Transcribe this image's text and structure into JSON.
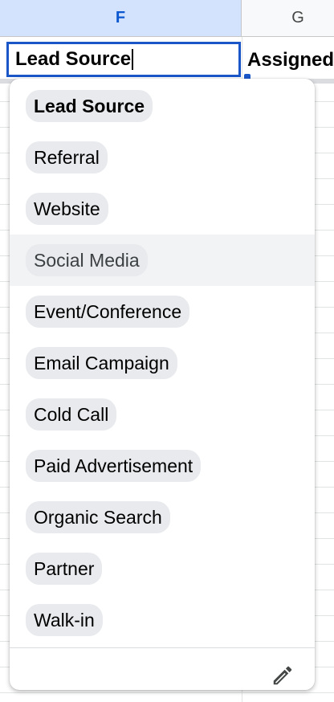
{
  "columns": {
    "f_label": "F",
    "g_label": "G"
  },
  "header_row": {
    "f_value": "Lead Source",
    "g_value": "Assigned"
  },
  "dropdown": {
    "options": [
      {
        "label": "Lead Source"
      },
      {
        "label": "Referral"
      },
      {
        "label": "Website"
      },
      {
        "label": "Social Media"
      },
      {
        "label": "Event/Conference"
      },
      {
        "label": "Email Campaign"
      },
      {
        "label": "Cold Call"
      },
      {
        "label": "Paid Advertisement"
      },
      {
        "label": "Organic Search"
      },
      {
        "label": "Partner"
      },
      {
        "label": "Walk-in"
      }
    ],
    "hovered_index": 3,
    "edit_icon": "pencil-icon"
  },
  "colors": {
    "selection_border": "#1a56c8",
    "selected_col_header_bg": "#d3e3fd",
    "chip_bg": "#e8eaed",
    "hover_row_bg": "#f1f3f4"
  }
}
